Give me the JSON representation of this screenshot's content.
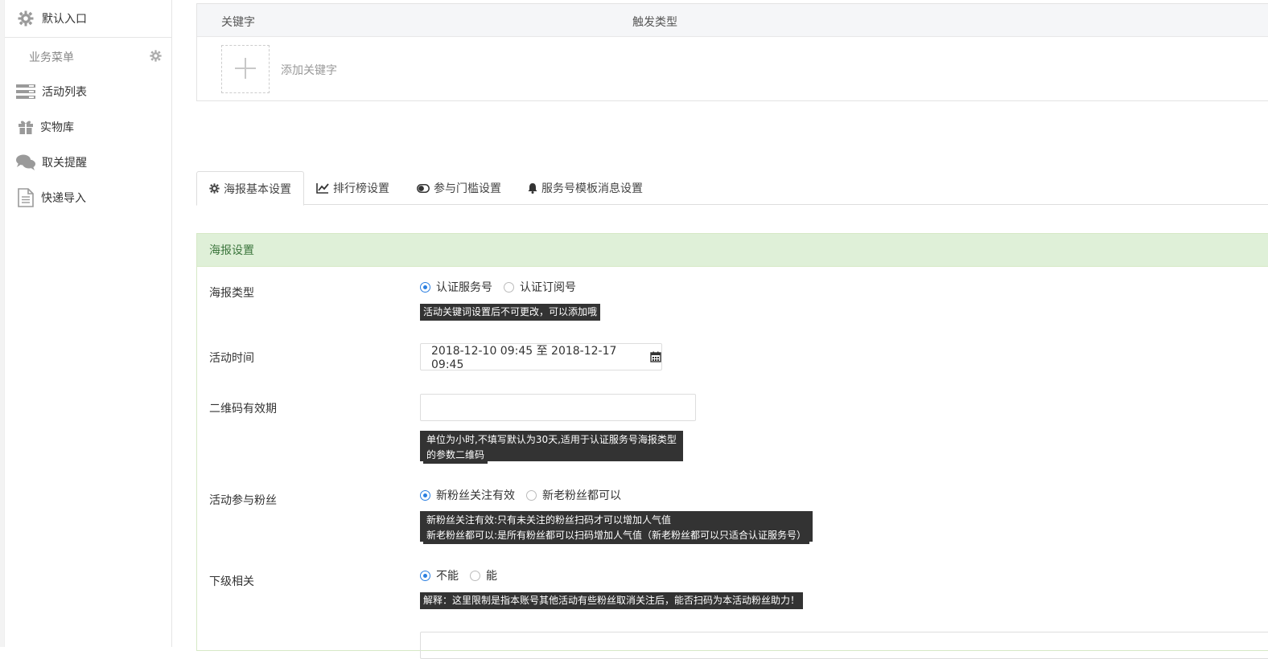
{
  "sidebar": {
    "default_entry": "默认入口",
    "group_label": "业务菜单",
    "items": [
      {
        "label": "活动列表",
        "icon": "list-icon"
      },
      {
        "label": "实物库",
        "icon": "gift-icon"
      },
      {
        "label": "取关提醒",
        "icon": "chat-icon"
      },
      {
        "label": "快递导入",
        "icon": "document-icon"
      }
    ]
  },
  "keywords": {
    "col_keyword": "关键字",
    "col_trigger": "触发类型",
    "add_label": "添加关键字"
  },
  "tabs": [
    {
      "label": "海报基本设置",
      "icon": "gear-icon",
      "active": true
    },
    {
      "label": "排行榜设置",
      "icon": "line-chart-icon",
      "active": false
    },
    {
      "label": "参与门槛设置",
      "icon": "toggle-icon",
      "active": false
    },
    {
      "label": "服务号模板消息设置",
      "icon": "bell-icon",
      "active": false
    }
  ],
  "panel": {
    "title": "海报设置",
    "poster_type": {
      "label": "海报类型",
      "options": [
        "认证服务号",
        "认证订阅号"
      ],
      "selected": 0,
      "hint": "活动关键词设置后不可更改，可以添加哦"
    },
    "activity_time": {
      "label": "活动时间",
      "value": "2018-12-10 09:45 至 2018-12-17 09:45"
    },
    "qr_validity": {
      "label": "二维码有效期",
      "value": "",
      "hint_lines": [
        "单位为小时,不填写默认为30天,适用于认证服务号海报类型",
        "的参数二维码"
      ]
    },
    "fans": {
      "label": "活动参与粉丝",
      "options": [
        "新粉丝关注有效",
        "新老粉丝都可以"
      ],
      "selected": 0,
      "hint_lines": [
        "新粉丝关注有效:只有未关注的粉丝扫码才可以增加人气值",
        "新老粉丝都可以:是所有粉丝都可以扫码增加人气值（新老粉丝都可以只适合认证服务号）"
      ]
    },
    "sub_related": {
      "label": "下级相关",
      "options": [
        "不能",
        "能"
      ],
      "selected": 0,
      "hint": "解释：这里限制是指本账号其他活动有些粉丝取消关注后，能否扫码为本活动粉丝助力！"
    }
  },
  "colors": {
    "accent": "#2b7fe0",
    "panel_head_bg": "#dff0d8",
    "panel_head_text": "#3c763d"
  }
}
